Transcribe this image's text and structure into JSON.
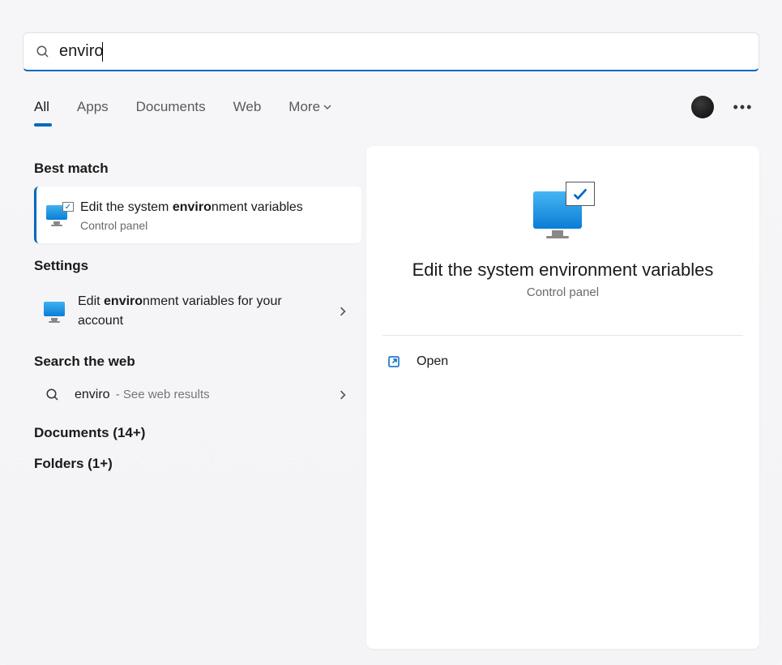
{
  "search": {
    "value": "enviro"
  },
  "tabs": [
    "All",
    "Apps",
    "Documents",
    "Web",
    "More"
  ],
  "activeTab": 0,
  "sections": {
    "bestMatch": "Best match",
    "settings": "Settings",
    "searchWeb": "Search the web",
    "documents": "Documents (14+)",
    "folders": "Folders (1+)"
  },
  "bestMatch": {
    "prefix": "Edit the system ",
    "bold": "enviro",
    "suffix": "nment variables",
    "sub": "Control panel"
  },
  "settingsResult": {
    "prefix": "Edit ",
    "bold": "enviro",
    "suffix": "nment variables for your account"
  },
  "webResult": {
    "term": "enviro",
    "hint": " - See web results"
  },
  "detail": {
    "title": "Edit the system environment variables",
    "sub": "Control panel",
    "openLabel": "Open"
  }
}
